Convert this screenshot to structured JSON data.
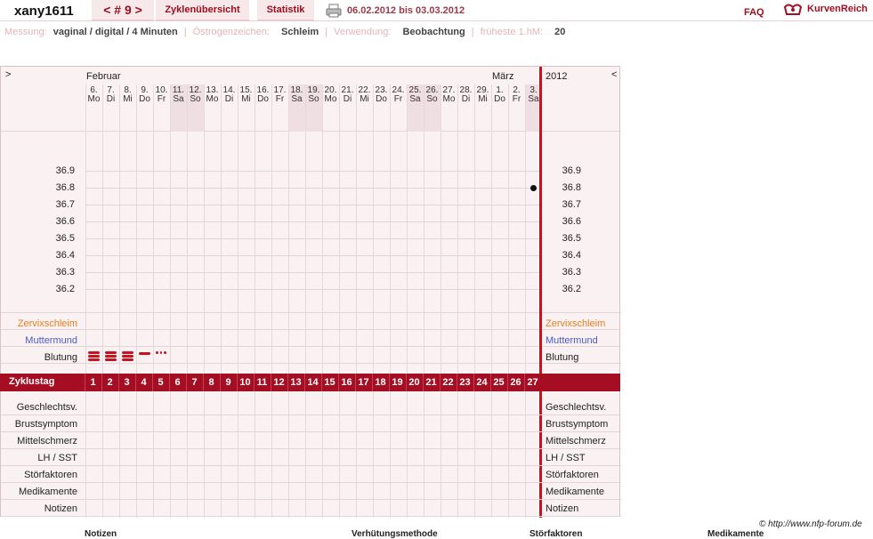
{
  "header": {
    "username": "xany1611",
    "cycle_nav": "< # 9 >",
    "tabs": [
      "Zyklenübersicht",
      "Statistik"
    ],
    "date_range": "06.02.2012 bis 03.03.2012",
    "faq": "FAQ",
    "brand": "KurvenReich"
  },
  "info": {
    "messung_label": "Messung:",
    "messung_value": "vaginal / digital / 4 Minuten",
    "oestrogen_label": "Östrogenzeichen:",
    "oestrogen_value": "Schleim",
    "verwendung_label": "Verwendung:",
    "verwendung_value": "Beobachtung",
    "hm_label": "früheste 1.hM:",
    "hm_value": "20"
  },
  "chart": {
    "nav_left": ">",
    "nav_right": "<",
    "month_feb": "Februar",
    "month_mar": "März",
    "year": "2012",
    "days": [
      {
        "d": "6.",
        "w": "Mo"
      },
      {
        "d": "7.",
        "w": "Di"
      },
      {
        "d": "8.",
        "w": "Mi"
      },
      {
        "d": "9.",
        "w": "Do"
      },
      {
        "d": "10.",
        "w": "Fr"
      },
      {
        "d": "11.",
        "w": "Sa"
      },
      {
        "d": "12.",
        "w": "So"
      },
      {
        "d": "13.",
        "w": "Mo"
      },
      {
        "d": "14.",
        "w": "Di"
      },
      {
        "d": "15.",
        "w": "Mi"
      },
      {
        "d": "16.",
        "w": "Do"
      },
      {
        "d": "17.",
        "w": "Fr"
      },
      {
        "d": "18.",
        "w": "Sa"
      },
      {
        "d": "19.",
        "w": "So"
      },
      {
        "d": "20.",
        "w": "Mo"
      },
      {
        "d": "21.",
        "w": "Di"
      },
      {
        "d": "22.",
        "w": "Mi"
      },
      {
        "d": "23.",
        "w": "Do"
      },
      {
        "d": "24.",
        "w": "Fr"
      },
      {
        "d": "25.",
        "w": "Sa"
      },
      {
        "d": "26.",
        "w": "So"
      },
      {
        "d": "27.",
        "w": "Mo"
      },
      {
        "d": "28.",
        "w": "Di"
      },
      {
        "d": "29.",
        "w": "Mi"
      },
      {
        "d": "1.",
        "w": "Do"
      },
      {
        "d": "2.",
        "w": "Fr"
      },
      {
        "d": "3.",
        "w": "Sa"
      }
    ],
    "temps": [
      "36.9",
      "36.8",
      "36.7",
      "36.6",
      "36.5",
      "36.4",
      "36.3",
      "36.2"
    ],
    "temperature_reading": {
      "day_index": 26,
      "value": 36.8
    },
    "rows_top": [
      "Zervixschleim",
      "Muttermund",
      "Blutung"
    ],
    "cycle_label": "Zyklustag",
    "cycle_days": [
      "1",
      "2",
      "3",
      "4",
      "5",
      "6",
      "7",
      "8",
      "9",
      "10",
      "11",
      "12",
      "13",
      "14",
      "15",
      "16",
      "17",
      "18",
      "19",
      "20",
      "21",
      "22",
      "23",
      "24",
      "25",
      "26",
      "27"
    ],
    "rows_bottom": [
      "Geschlechtsv.",
      "Brustsymptom",
      "Mittelschmerz",
      "LH / SST",
      "Störfaktoren",
      "Medikamente",
      "Notizen"
    ],
    "bleeding": [
      3,
      3,
      3,
      2,
      1
    ]
  },
  "colors": {
    "accent": "#a40d22",
    "zervix": "#e87e1a",
    "muttermund": "#4a5bc4"
  },
  "footer": {
    "copyright": "© http://www.nfp-forum.de",
    "col_notizen": "Notizen",
    "col_verhuetung": "Verhütungsmethode",
    "col_stoerfaktoren": "Störfaktoren",
    "col_medikamente": "Medikamente"
  }
}
